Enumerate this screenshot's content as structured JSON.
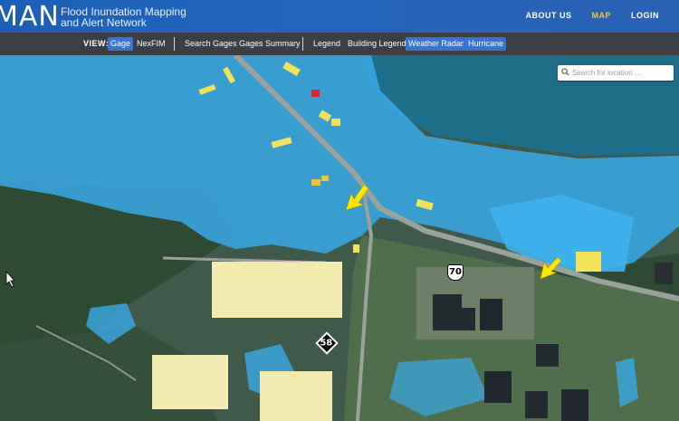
{
  "header": {
    "logo_text": "MAN",
    "subtitle_line1": "Flood Inundation Mapping",
    "subtitle_line2": "and Alert Network",
    "nav": [
      {
        "label": "ABOUT US",
        "active": false
      },
      {
        "label": "MAP",
        "active": true
      },
      {
        "label": "LOGIN",
        "active": false
      }
    ]
  },
  "viewbar": {
    "label": "VIEW:",
    "gage": "Gage",
    "nexfim": "NexFIM",
    "search_gages": "Search Gages",
    "gages_summary": "Gages Summary",
    "legend": "Legend",
    "building_legend": "Building Legend",
    "weather_radar": "Weather Radar",
    "hurricane": "Hurricane"
  },
  "search": {
    "placeholder": "Search for location ..."
  },
  "map": {
    "route_shields": [
      {
        "number": "70",
        "type": "us-route"
      },
      {
        "number": "58",
        "type": "state-route"
      }
    ],
    "colors": {
      "flood": "#39a9e6",
      "water": "#1f6e8a",
      "building_flooded": "#f2e25a",
      "building_alert": "#e0232a",
      "marker_arrow": "#ffe600",
      "active_button": "#3772d6",
      "map_active_link": "#f2c33a"
    }
  }
}
